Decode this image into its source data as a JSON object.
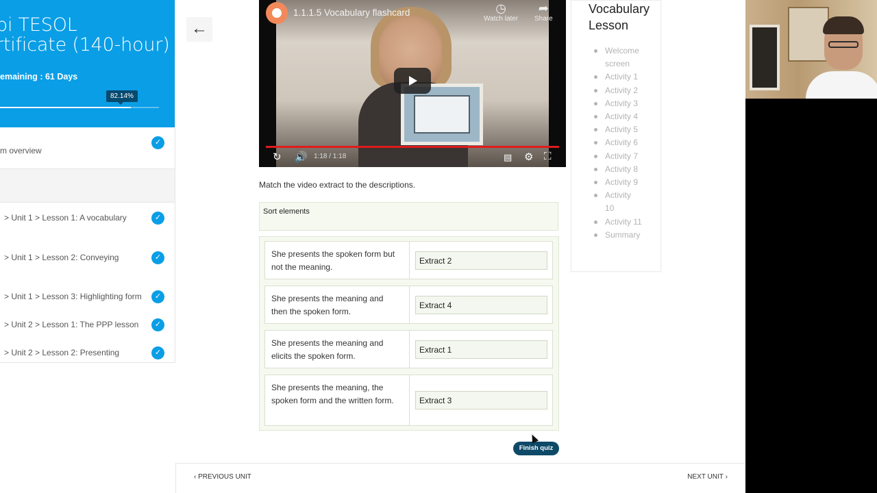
{
  "sidebar": {
    "course_title": "pi TESOL\nrtificate (140-hour)",
    "remaining": "emaining : 61 Days",
    "progress_label": "82.14%",
    "progress_value": 82.14,
    "items": [
      {
        "label": "m overview",
        "done": true
      },
      {
        "label": "> Unit 1 > Lesson 1: A vocabulary",
        "done": true
      },
      {
        "label": "> Unit 1 > Lesson 2: Conveying",
        "done": true
      },
      {
        "label": "> Unit 1 > Lesson 3: Highlighting form",
        "done": true
      },
      {
        "label": "> Unit 2 > Lesson 1: The PPP lesson",
        "done": true
      },
      {
        "label": "> Unit 2 > Lesson 2: Presenting",
        "done": true
      }
    ],
    "check_glyph": "✓"
  },
  "back_button": {
    "glyph": "←"
  },
  "video": {
    "title": "1.1.1.5 Vocabulary flashcard",
    "watch_later": "Watch later",
    "share": "Share",
    "time": "1:18 / 1:18",
    "watch_later_icon": "clock-icon",
    "share_icon": "share-arrow-icon"
  },
  "quiz": {
    "question": "Match the video extract to the descriptions.",
    "sort_label": "Sort elements",
    "rows": [
      {
        "description": "She presents the spoken form but not the meaning.",
        "answer": "Extract 2"
      },
      {
        "description": "She presents the meaning and then the spoken form.",
        "answer": "Extract 4"
      },
      {
        "description": "She presents the meaning and elicits the spoken form.",
        "answer": "Extract 1"
      },
      {
        "description": "She presents the meaning, the spoken form and the written form.",
        "answer": "Extract 3"
      }
    ],
    "finish_label": "Finish quiz"
  },
  "toc": {
    "title": "Vocabulary\nLesson",
    "items": [
      "Welcome screen",
      "Activity 1",
      "Activity 2",
      "Activity 3",
      "Activity 4",
      "Activity 5",
      "Activity 6",
      "Activity 7",
      "Activity 8",
      "Activity 9",
      "Activity 10",
      "Activity 11",
      "Summary"
    ]
  },
  "nav": {
    "prev": "PREVIOUS UNIT",
    "next": "NEXT UNIT"
  },
  "colors": {
    "brand_blue": "#0a9ee6",
    "finish_button": "#0e4a68",
    "video_progress": "#e01b1b"
  }
}
